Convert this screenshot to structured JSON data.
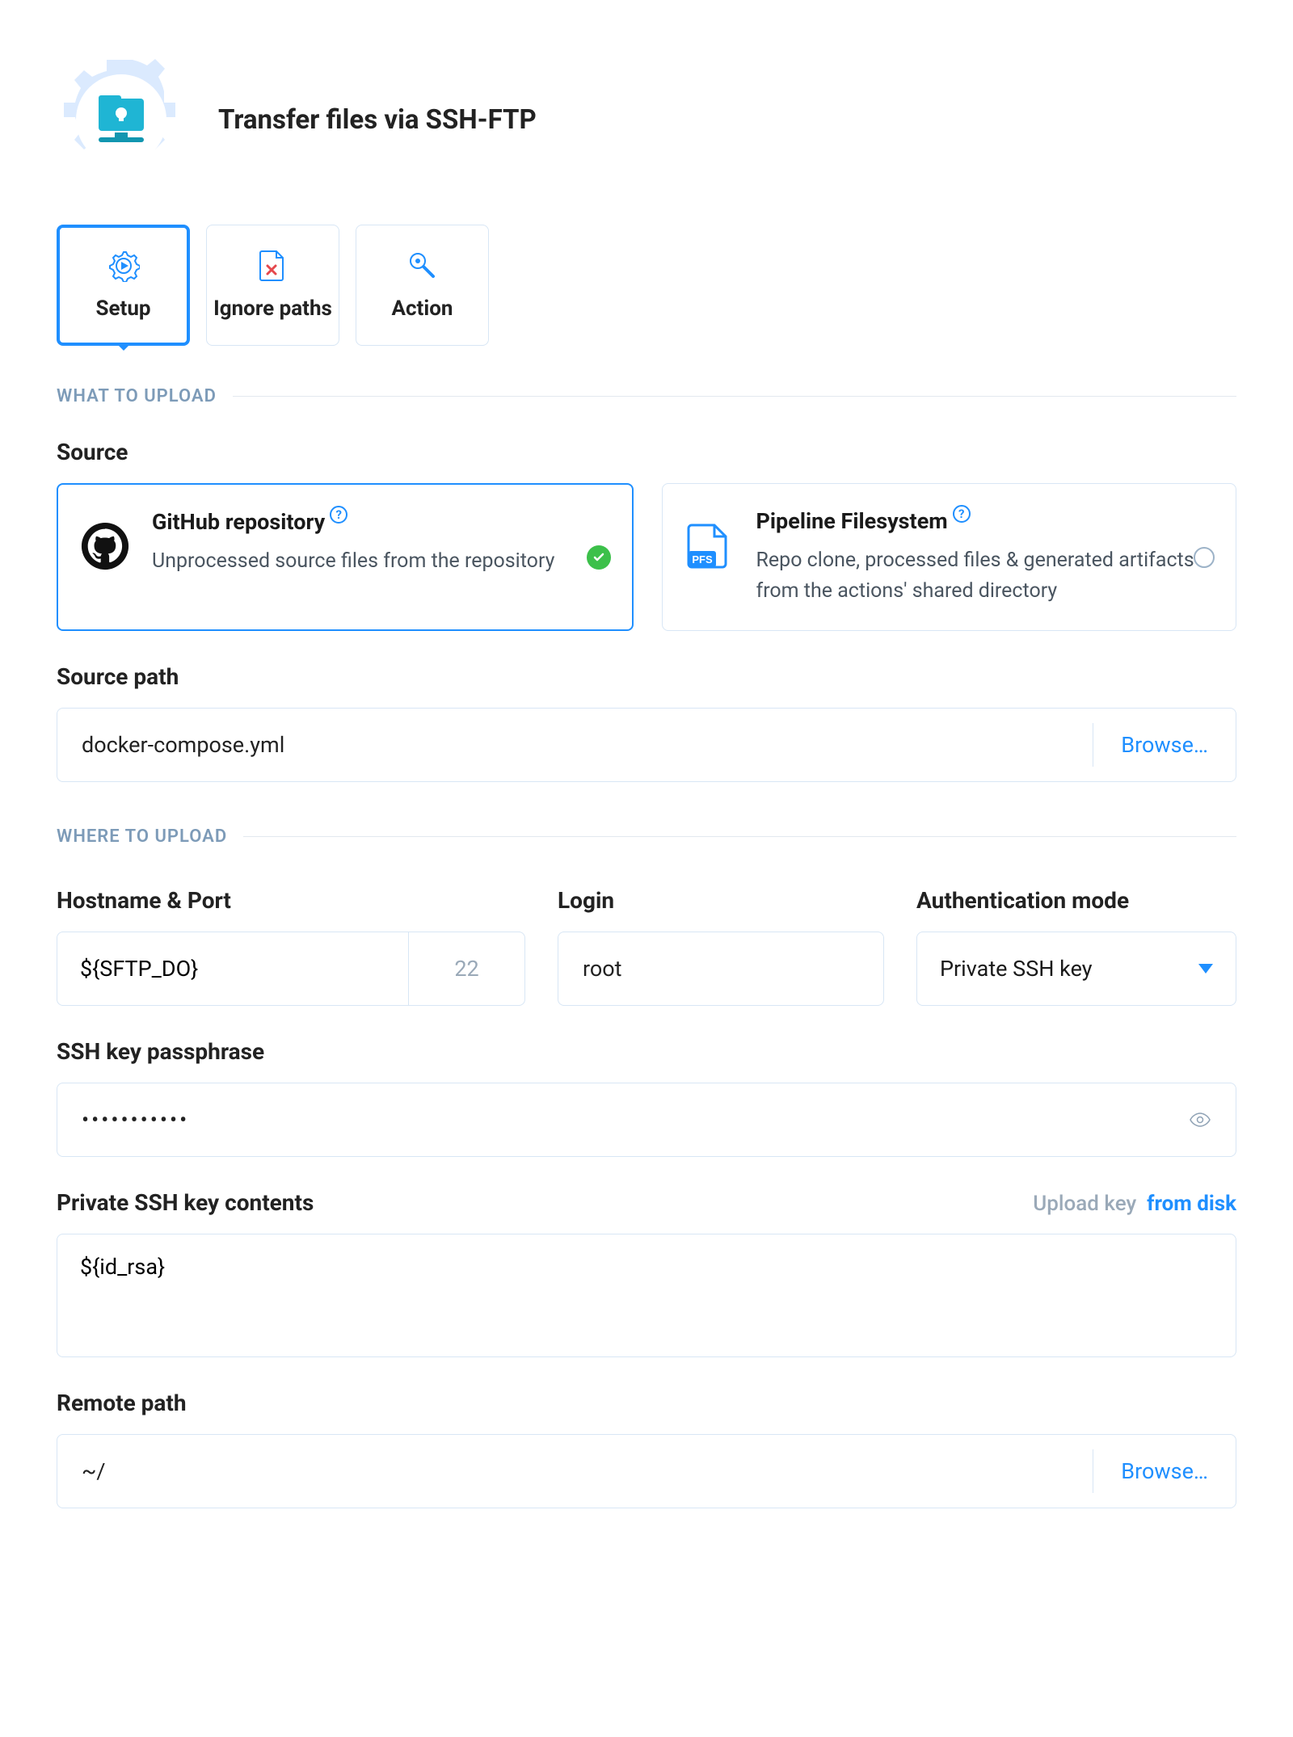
{
  "header": {
    "title": "Transfer files via SSH-FTP"
  },
  "tabs": [
    {
      "label": "Setup",
      "active": true
    },
    {
      "label": "Ignore paths",
      "active": false
    },
    {
      "label": "Action",
      "active": false
    }
  ],
  "sections": {
    "what_to_upload": "WHAT TO UPLOAD",
    "where_to_upload": "WHERE TO UPLOAD"
  },
  "source": {
    "label": "Source",
    "options": [
      {
        "title": "GitHub repository",
        "desc": "Unprocessed source files from the repository",
        "selected": true
      },
      {
        "title": "Pipeline Filesystem",
        "desc": "Repo clone, processed files & generated artifacts from the actions' shared directory",
        "selected": false
      }
    ]
  },
  "source_path": {
    "label": "Source path",
    "value": "docker-compose.yml",
    "browse": "Browse…"
  },
  "hostport": {
    "label": "Hostname & Port",
    "host": "${SFTP_DO}",
    "port": "22"
  },
  "login": {
    "label": "Login",
    "value": "root"
  },
  "auth_mode": {
    "label": "Authentication mode",
    "value": "Private SSH key"
  },
  "passphrase": {
    "label": "SSH key passphrase",
    "value": "•••••••••••"
  },
  "private_key": {
    "label": "Private SSH key contents",
    "hint_muted": "Upload key",
    "hint_link": "from disk",
    "value": "${id_rsa}"
  },
  "remote_path": {
    "label": "Remote path",
    "value": "~/",
    "browse": "Browse…"
  }
}
